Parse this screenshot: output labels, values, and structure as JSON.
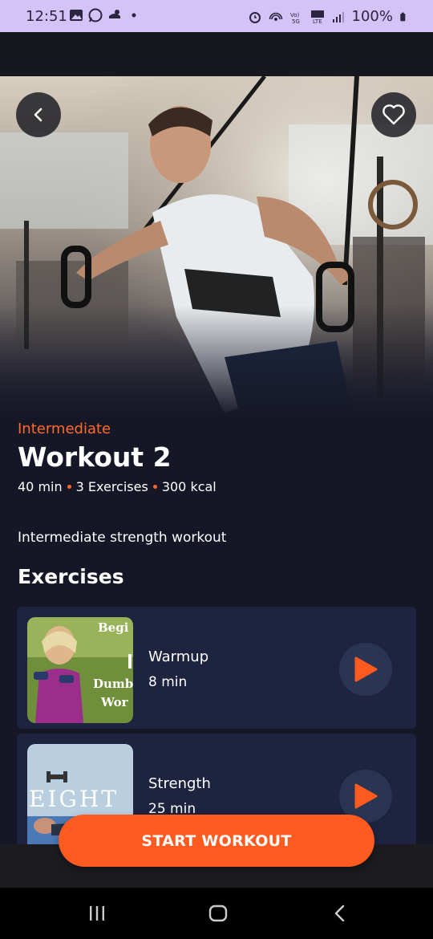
{
  "status_bar": {
    "time": "12:51",
    "battery": "100%",
    "left_icons": [
      "gallery-icon",
      "whatsapp-icon",
      "chef-hat-icon",
      "dot-icon"
    ],
    "right_icons": [
      "alarm-icon",
      "hotspot-icon",
      "volte-icon",
      "5g-icon",
      "signal-icon",
      "battery-icon"
    ]
  },
  "header": {
    "back_icon": "chevron-left-icon",
    "favorite_icon": "heart-icon"
  },
  "workout": {
    "level": "Intermediate",
    "title": "Workout 2",
    "duration": "40 min",
    "exercise_count": "3 Exercises",
    "calories": "300 kcal",
    "description": "Intermediate strength workout"
  },
  "exercises_section": {
    "title": "Exercises",
    "items": [
      {
        "name": "Warmup",
        "duration": "8 min",
        "thumb_text": [
          "Begi",
          "Dumb",
          "Wor"
        ]
      },
      {
        "name": "Strength",
        "duration": "25 min",
        "thumb_text": [
          "EIGHT"
        ]
      }
    ]
  },
  "start_button": {
    "label": "START WORKOUT"
  },
  "colors": {
    "accent": "#ff5a1f",
    "background": "#151726",
    "card": "#1e2340",
    "status_bar": "#d4c3f7"
  }
}
